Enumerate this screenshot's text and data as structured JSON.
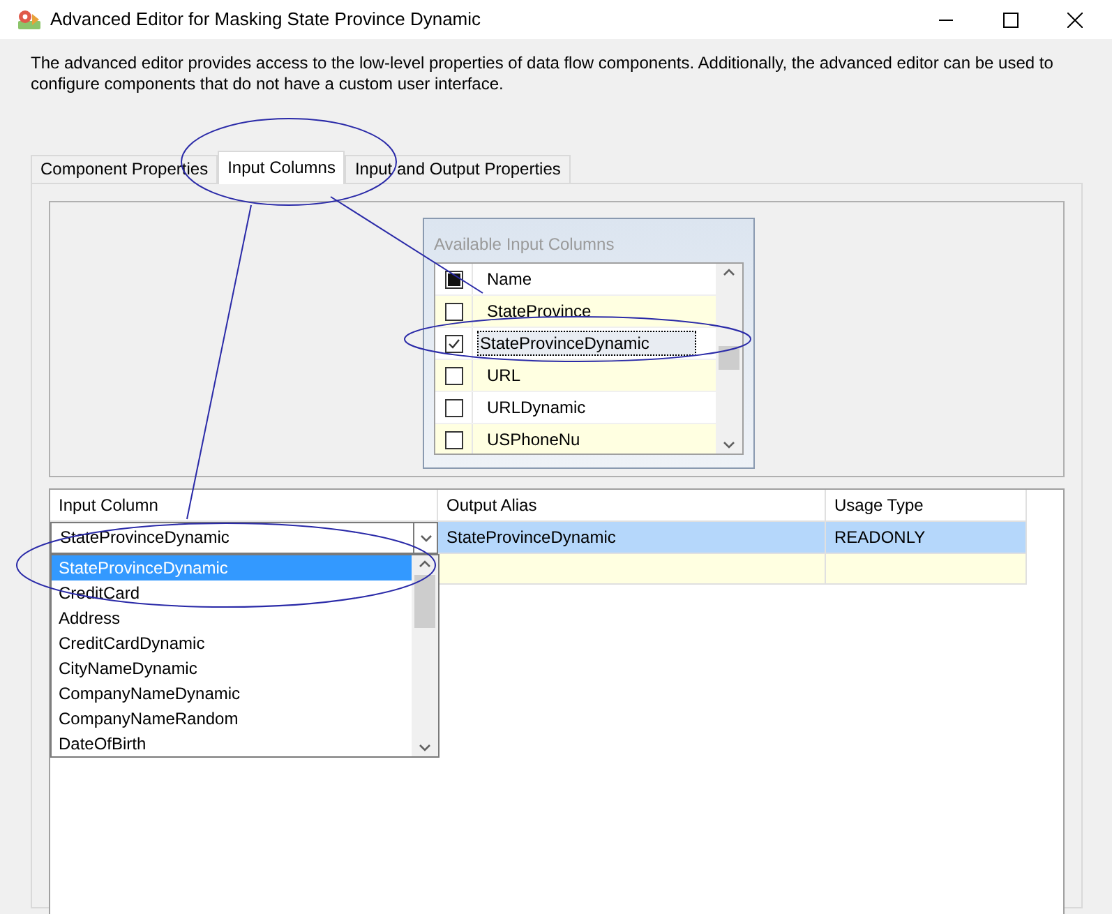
{
  "window": {
    "title": "Advanced Editor for Masking State Province Dynamic"
  },
  "description": "The advanced editor provides access to the low-level properties of data flow components. Additionally, the advanced editor can be used to configure components that do not have a custom user interface.",
  "tabs": [
    {
      "label": "Component Properties",
      "selected": false
    },
    {
      "label": "Input Columns",
      "selected": true
    },
    {
      "label": "Input and Output Properties",
      "selected": false
    }
  ],
  "available_columns": {
    "title": "Available Input Columns",
    "header": {
      "label": "Name",
      "indeterminate": true
    },
    "rows": [
      {
        "name": "StateProvince",
        "checked": false,
        "selected": false
      },
      {
        "name": "StateProvinceDynamic",
        "checked": true,
        "selected": true
      },
      {
        "name": "URL",
        "checked": false,
        "selected": false
      },
      {
        "name": "URLDynamic",
        "checked": false,
        "selected": false
      },
      {
        "name": "USPhoneNu",
        "checked": false,
        "selected": false
      }
    ]
  },
  "grid": {
    "columns": [
      "Input Column",
      "Output Alias",
      "Usage Type"
    ],
    "rows": [
      {
        "input_column": "StateProvinceDynamic",
        "output_alias": "StateProvinceDynamic",
        "usage_type": "READONLY",
        "selected": true
      }
    ],
    "new_row": true
  },
  "dropdown": {
    "open": true,
    "options": [
      {
        "label": "StateProvinceDynamic",
        "selected": true
      },
      {
        "label": "CreditCard",
        "selected": false
      },
      {
        "label": "Address",
        "selected": false
      },
      {
        "label": "CreditCardDynamic",
        "selected": false
      },
      {
        "label": "CityNameDynamic",
        "selected": false
      },
      {
        "label": "CompanyNameDynamic",
        "selected": false
      },
      {
        "label": "CompanyNameRandom",
        "selected": false
      },
      {
        "label": "DateOfBirth",
        "selected": false
      }
    ]
  }
}
